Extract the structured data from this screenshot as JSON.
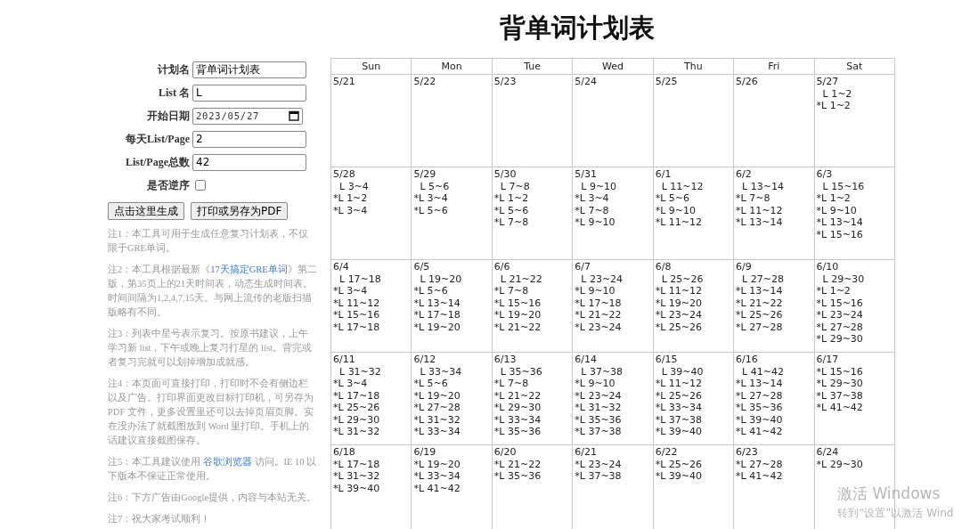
{
  "title": "背单词计划表",
  "form": {
    "fields": [
      {
        "label": "计划名",
        "kind": "text",
        "value": "背单词计划表"
      },
      {
        "label": "List 名",
        "kind": "text",
        "value": "L"
      },
      {
        "label": "开始日期",
        "kind": "date",
        "value": "2023/05/27"
      },
      {
        "label": "每天List/Page",
        "kind": "text",
        "value": "2"
      },
      {
        "label": "List/Page总数",
        "kind": "text",
        "value": "42"
      },
      {
        "label": "是否逆序",
        "kind": "checkbox",
        "checked": false
      }
    ],
    "buttons": [
      "点击这里生成",
      "打印或另存为PDF"
    ]
  },
  "notes": [
    {
      "before": "注1：本工具可用于生成任意复习计划表，不仅限于GRE单词。"
    },
    {
      "before": "注2：本工具根据最新《",
      "link": "17天搞定GRE单词",
      "after": "》第二版，第35页上的21天时间表，动态生成时间表。时间间隔为1,2,4,7,15天。与网上流传的老版扫描版略有不同。"
    },
    {
      "before": "注3：列表中星号表示复习。按原书建议，上午学习新 list，下午或晚上复习打星的 list。背完或者复习完就可以划掉增加成就感。"
    },
    {
      "before": "注4：本页面可直接打印，打印时不会有侧边栏以及广告。打印界面更改目标打印机，可另存为 PDF 文件，更多设置里还可以去掉页眉页脚。实在没办法了就截图放到 Word 里打印。手机上的话建议直接截图保存。"
    },
    {
      "before": "注5：本工具建议使用 ",
      "link": "谷歌浏览器",
      "after": " 访问。IE 10 以下版本不保证正常使用。"
    },
    {
      "before": "注6：下方广告由Google提供，内容与本站无关。"
    },
    {
      "before": "注7：祝大家考试顺利！"
    }
  ],
  "calendar": {
    "columns": [
      "Sun",
      "Mon",
      "Tue",
      "Wed",
      "Thu",
      "Fri",
      "Sat"
    ],
    "weeks": [
      [
        {
          "date": "5/21"
        },
        {
          "date": "5/22"
        },
        {
          "date": "5/23"
        },
        {
          "date": "5/24"
        },
        {
          "date": "5/25"
        },
        {
          "date": "5/26"
        },
        {
          "date": "5/27",
          "entries": [
            {
              "kind": "new",
              "text": "L 1~2"
            },
            {
              "kind": "review",
              "text": "*L 1~2"
            }
          ]
        }
      ],
      [
        {
          "date": "5/28",
          "entries": [
            {
              "kind": "new",
              "text": "L 3~4"
            },
            {
              "kind": "review",
              "text": "*L 1~2"
            },
            {
              "kind": "review",
              "text": "*L 3~4"
            }
          ]
        },
        {
          "date": "5/29",
          "entries": [
            {
              "kind": "new",
              "text": "L 5~6"
            },
            {
              "kind": "review",
              "text": "*L 3~4"
            },
            {
              "kind": "review",
              "text": "*L 5~6"
            }
          ]
        },
        {
          "date": "5/30",
          "entries": [
            {
              "kind": "new",
              "text": "L 7~8"
            },
            {
              "kind": "review",
              "text": "*L 1~2"
            },
            {
              "kind": "review",
              "text": "*L 5~6"
            },
            {
              "kind": "review",
              "text": "*L 7~8"
            }
          ]
        },
        {
          "date": "5/31",
          "entries": [
            {
              "kind": "new",
              "text": "L 9~10"
            },
            {
              "kind": "review",
              "text": "*L 3~4"
            },
            {
              "kind": "review",
              "text": "*L 7~8"
            },
            {
              "kind": "review",
              "text": "*L 9~10"
            }
          ]
        },
        {
          "date": "6/1",
          "entries": [
            {
              "kind": "new",
              "text": "L 11~12"
            },
            {
              "kind": "review",
              "text": "*L 5~6"
            },
            {
              "kind": "review",
              "text": "*L 9~10"
            },
            {
              "kind": "review",
              "text": "*L 11~12"
            }
          ]
        },
        {
          "date": "6/2",
          "entries": [
            {
              "kind": "new",
              "text": "L 13~14"
            },
            {
              "kind": "review",
              "text": "*L 7~8"
            },
            {
              "kind": "review",
              "text": "*L 11~12"
            },
            {
              "kind": "review",
              "text": "*L 13~14"
            }
          ]
        },
        {
          "date": "6/3",
          "entries": [
            {
              "kind": "new",
              "text": "L 15~16"
            },
            {
              "kind": "review",
              "text": "*L 1~2"
            },
            {
              "kind": "review",
              "text": "*L 9~10"
            },
            {
              "kind": "review",
              "text": "*L 13~14"
            },
            {
              "kind": "review",
              "text": "*L 15~16"
            }
          ]
        }
      ],
      [
        {
          "date": "6/4",
          "entries": [
            {
              "kind": "new",
              "text": "L 17~18"
            },
            {
              "kind": "review",
              "text": "*L 3~4"
            },
            {
              "kind": "review",
              "text": "*L 11~12"
            },
            {
              "kind": "review",
              "text": "*L 15~16"
            },
            {
              "kind": "review",
              "text": "*L 17~18"
            }
          ]
        },
        {
          "date": "6/5",
          "entries": [
            {
              "kind": "new",
              "text": "L 19~20"
            },
            {
              "kind": "review",
              "text": "*L 5~6"
            },
            {
              "kind": "review",
              "text": "*L 13~14"
            },
            {
              "kind": "review",
              "text": "*L 17~18"
            },
            {
              "kind": "review",
              "text": "*L 19~20"
            }
          ]
        },
        {
          "date": "6/6",
          "entries": [
            {
              "kind": "new",
              "text": "L 21~22"
            },
            {
              "kind": "review",
              "text": "*L 7~8"
            },
            {
              "kind": "review",
              "text": "*L 15~16"
            },
            {
              "kind": "review",
              "text": "*L 19~20"
            },
            {
              "kind": "review",
              "text": "*L 21~22"
            }
          ]
        },
        {
          "date": "6/7",
          "entries": [
            {
              "kind": "new",
              "text": "L 23~24"
            },
            {
              "kind": "review",
              "text": "*L 9~10"
            },
            {
              "kind": "review",
              "text": "*L 17~18"
            },
            {
              "kind": "review",
              "text": "*L 21~22"
            },
            {
              "kind": "review",
              "text": "*L 23~24"
            }
          ]
        },
        {
          "date": "6/8",
          "entries": [
            {
              "kind": "new",
              "text": "L 25~26"
            },
            {
              "kind": "review",
              "text": "*L 11~12"
            },
            {
              "kind": "review",
              "text": "*L 19~20"
            },
            {
              "kind": "review",
              "text": "*L 23~24"
            },
            {
              "kind": "review",
              "text": "*L 25~26"
            }
          ]
        },
        {
          "date": "6/9",
          "entries": [
            {
              "kind": "new",
              "text": "L 27~28"
            },
            {
              "kind": "review",
              "text": "*L 13~14"
            },
            {
              "kind": "review",
              "text": "*L 21~22"
            },
            {
              "kind": "review",
              "text": "*L 25~26"
            },
            {
              "kind": "review",
              "text": "*L 27~28"
            }
          ]
        },
        {
          "date": "6/10",
          "entries": [
            {
              "kind": "new",
              "text": "L 29~30"
            },
            {
              "kind": "review",
              "text": "*L 1~2"
            },
            {
              "kind": "review",
              "text": "*L 15~16"
            },
            {
              "kind": "review",
              "text": "*L 23~24"
            },
            {
              "kind": "review",
              "text": "*L 27~28"
            },
            {
              "kind": "review",
              "text": "*L 29~30"
            }
          ]
        }
      ],
      [
        {
          "date": "6/11",
          "entries": [
            {
              "kind": "new",
              "text": "L 31~32"
            },
            {
              "kind": "review",
              "text": "*L 3~4"
            },
            {
              "kind": "review",
              "text": "*L 17~18"
            },
            {
              "kind": "review",
              "text": "*L 25~26"
            },
            {
              "kind": "review",
              "text": "*L 29~30"
            },
            {
              "kind": "review",
              "text": "*L 31~32"
            }
          ]
        },
        {
          "date": "6/12",
          "entries": [
            {
              "kind": "new",
              "text": "L 33~34"
            },
            {
              "kind": "review",
              "text": "*L 5~6"
            },
            {
              "kind": "review",
              "text": "*L 19~20"
            },
            {
              "kind": "review",
              "text": "*L 27~28"
            },
            {
              "kind": "review",
              "text": "*L 31~32"
            },
            {
              "kind": "review",
              "text": "*L 33~34"
            }
          ]
        },
        {
          "date": "6/13",
          "entries": [
            {
              "kind": "new",
              "text": "L 35~36"
            },
            {
              "kind": "review",
              "text": "*L 7~8"
            },
            {
              "kind": "review",
              "text": "*L 21~22"
            },
            {
              "kind": "review",
              "text": "*L 29~30"
            },
            {
              "kind": "review",
              "text": "*L 33~34"
            },
            {
              "kind": "review",
              "text": "*L 35~36"
            }
          ]
        },
        {
          "date": "6/14",
          "entries": [
            {
              "kind": "new",
              "text": "L 37~38"
            },
            {
              "kind": "review",
              "text": "*L 9~10"
            },
            {
              "kind": "review",
              "text": "*L 23~24"
            },
            {
              "kind": "review",
              "text": "*L 31~32"
            },
            {
              "kind": "review",
              "text": "*L 35~36"
            },
            {
              "kind": "review",
              "text": "*L 37~38"
            }
          ]
        },
        {
          "date": "6/15",
          "entries": [
            {
              "kind": "new",
              "text": "L 39~40"
            },
            {
              "kind": "review",
              "text": "*L 11~12"
            },
            {
              "kind": "review",
              "text": "*L 25~26"
            },
            {
              "kind": "review",
              "text": "*L 33~34"
            },
            {
              "kind": "review",
              "text": "*L 37~38"
            },
            {
              "kind": "review",
              "text": "*L 39~40"
            }
          ]
        },
        {
          "date": "6/16",
          "entries": [
            {
              "kind": "new",
              "text": "L 41~42"
            },
            {
              "kind": "review",
              "text": "*L 13~14"
            },
            {
              "kind": "review",
              "text": "*L 27~28"
            },
            {
              "kind": "review",
              "text": "*L 35~36"
            },
            {
              "kind": "review",
              "text": "*L 39~40"
            },
            {
              "kind": "review",
              "text": "*L 41~42"
            }
          ]
        },
        {
          "date": "6/17",
          "entries": [
            {
              "kind": "review",
              "text": "*L 15~16"
            },
            {
              "kind": "review",
              "text": "*L 29~30"
            },
            {
              "kind": "review",
              "text": "*L 37~38"
            },
            {
              "kind": "review",
              "text": "*L 41~42"
            }
          ]
        }
      ],
      [
        {
          "date": "6/18",
          "entries": [
            {
              "kind": "review",
              "text": "*L 17~18"
            },
            {
              "kind": "review",
              "text": "*L 31~32"
            },
            {
              "kind": "review",
              "text": "*L 39~40"
            }
          ]
        },
        {
          "date": "6/19",
          "entries": [
            {
              "kind": "review",
              "text": "*L 19~20"
            },
            {
              "kind": "review",
              "text": "*L 33~34"
            },
            {
              "kind": "review",
              "text": "*L 41~42"
            }
          ]
        },
        {
          "date": "6/20",
          "entries": [
            {
              "kind": "review",
              "text": "*L 21~22"
            },
            {
              "kind": "review",
              "text": "*L 35~36"
            }
          ]
        },
        {
          "date": "6/21",
          "entries": [
            {
              "kind": "review",
              "text": "*L 23~24"
            },
            {
              "kind": "review",
              "text": "*L 37~38"
            }
          ]
        },
        {
          "date": "6/22",
          "entries": [
            {
              "kind": "review",
              "text": "*L 25~26"
            },
            {
              "kind": "review",
              "text": "*L 39~40"
            }
          ]
        },
        {
          "date": "6/23",
          "entries": [
            {
              "kind": "review",
              "text": "*L 27~28"
            },
            {
              "kind": "review",
              "text": "*L 41~42"
            }
          ]
        },
        {
          "date": "6/24",
          "entries": [
            {
              "kind": "review",
              "text": "*L 29~30"
            }
          ]
        }
      ]
    ]
  },
  "activation_notice": {
    "title": "激活 Windows",
    "subtitle": "转到“设置”以激活 Wind"
  }
}
